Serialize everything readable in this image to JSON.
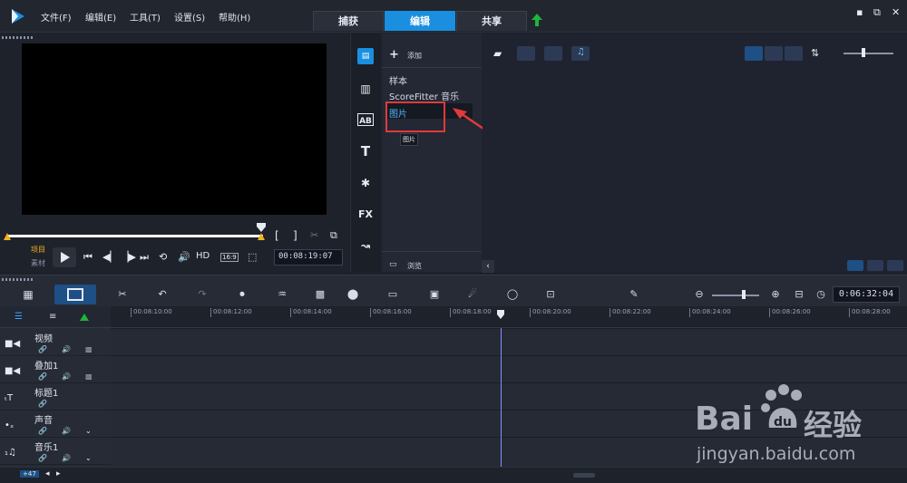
{
  "menu": [
    "文件(F)",
    "编辑(E)",
    "工具(T)",
    "设置(S)",
    "帮助(H)"
  ],
  "mode_tabs": [
    "捕获",
    "编辑",
    "共享"
  ],
  "window_controls": [
    "▪",
    "⧉",
    "✕"
  ],
  "preview": {
    "project_label": "项目",
    "clip_label": "素材",
    "hd_label": "HD",
    "aspect_label": "16:9",
    "timecode": "00:08:19:07",
    "bracket_in": "[",
    "bracket_out": "]"
  },
  "library": {
    "add_label": "添加",
    "items": [
      "样本",
      "ScoreFitter 音乐",
      "图片"
    ],
    "tooltip": "图片",
    "browse_label": "浏览",
    "sidebar": [
      "AB",
      "T",
      "FX"
    ]
  },
  "timeline": {
    "timecode": "0:06:32:04",
    "ruler": [
      "00:08:10:00",
      "00:08:12:00",
      "00:08:14:00",
      "00:08:16:00",
      "00:08:18:00",
      "00:08:20:00",
      "00:08:22:00",
      "00:08:24:00",
      "00:08:26:00",
      "00:08:28:00"
    ],
    "tracks": [
      "视频",
      "叠加1",
      "标题1",
      "声音",
      "音乐1"
    ],
    "bottom_badge": "+47"
  },
  "watermark": {
    "brand_left": "Bai",
    "brand_right": "经验",
    "url": "jingyan.baidu.com"
  },
  "colors": {
    "accent": "#1a8fe0",
    "highlight_box": "#e03a3a",
    "arrow": "#e03a3a",
    "green_arrow": "#1eb53a",
    "watermark": "#bfc5cf"
  }
}
